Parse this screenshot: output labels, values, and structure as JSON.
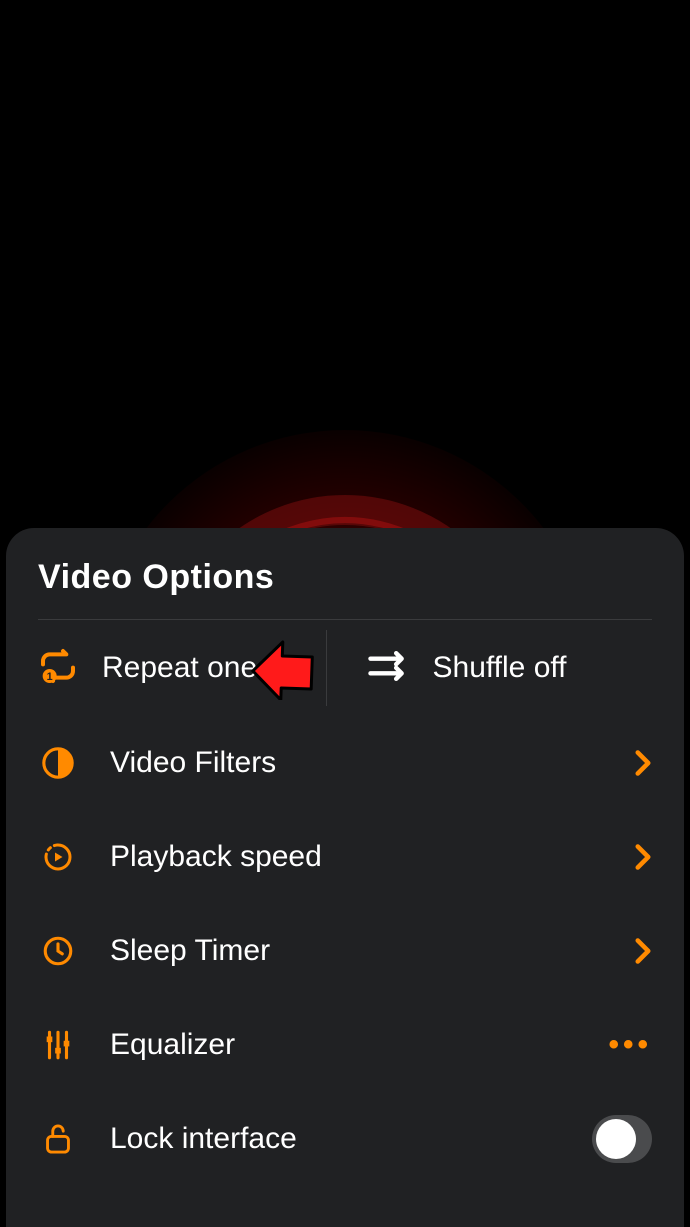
{
  "panel": {
    "title": "Video Options",
    "repeat": {
      "label": "Repeat one"
    },
    "shuffle": {
      "label": "Shuffle off"
    },
    "items": {
      "filters": {
        "label": "Video Filters"
      },
      "speed": {
        "label": "Playback speed"
      },
      "sleep": {
        "label": "Sleep Timer"
      },
      "equalizer": {
        "label": "Equalizer"
      },
      "lock": {
        "label": "Lock interface",
        "enabled": false
      }
    }
  },
  "colors": {
    "accent": "#ff8a00"
  }
}
